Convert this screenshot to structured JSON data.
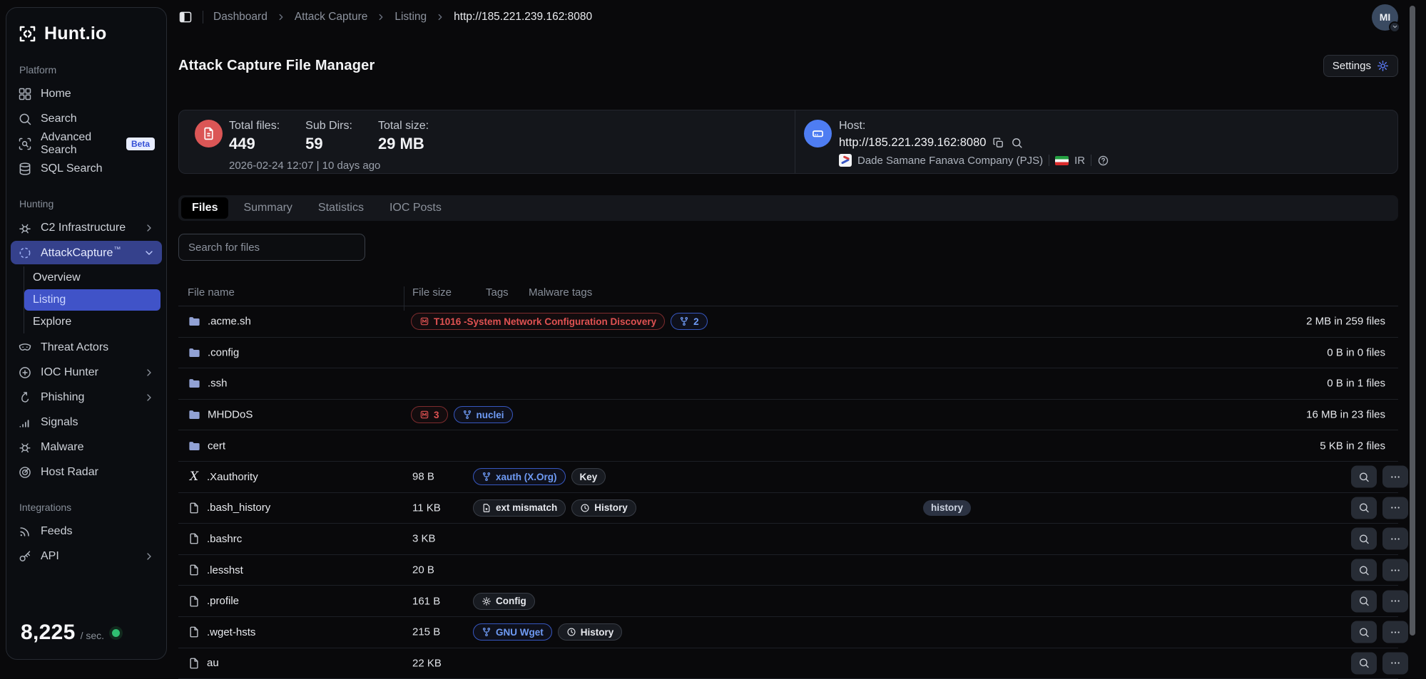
{
  "colors": {
    "accent": "#5c7cfa",
    "danger": "#e05252",
    "success": "#2fbf71",
    "active_nav": "#4053c8"
  },
  "sidebar": {
    "brand": "Hunt.io",
    "sections": [
      {
        "label": "Platform",
        "items": [
          {
            "label": "Home"
          },
          {
            "label": "Search"
          },
          {
            "label": "Advanced Search",
            "badge": "Beta"
          },
          {
            "label": "SQL Search"
          }
        ]
      },
      {
        "label": "Hunting",
        "items": [
          {
            "label": "C2 Infrastructure"
          },
          {
            "label": "AttackCapture",
            "tm": "™"
          },
          {
            "label": "Threat Actors"
          },
          {
            "label": "IOC Hunter"
          },
          {
            "label": "Phishing"
          },
          {
            "label": "Signals"
          },
          {
            "label": "Malware"
          },
          {
            "label": "Host Radar"
          }
        ]
      },
      {
        "label": "Integrations",
        "items": [
          {
            "label": "Feeds"
          },
          {
            "label": "API"
          }
        ]
      }
    ],
    "attackcapture_children": [
      {
        "label": "Overview"
      },
      {
        "label": "Listing"
      },
      {
        "label": "Explore"
      }
    ],
    "rate": {
      "value": "8,225",
      "unit": "/ sec."
    }
  },
  "topbar": {
    "breadcrumb": [
      "Dashboard",
      "Attack Capture",
      "Listing"
    ],
    "current": "http://185.221.239.162:8080",
    "avatar": "MI"
  },
  "header": {
    "title": "Attack Capture File Manager",
    "settings_label": "Settings"
  },
  "overview": {
    "stats": [
      {
        "label": "Total files:",
        "value": "449"
      },
      {
        "label": "Sub Dirs:",
        "value": "59"
      },
      {
        "label": "Total size:",
        "value": "29 MB"
      }
    ],
    "timestamp": "2026-02-24 12:07 | 10 days ago",
    "host": {
      "label": "Host:",
      "url": "http://185.221.239.162:8080",
      "org": "Dade Samane Fanava Company (PJS)",
      "country": "IR"
    }
  },
  "tabs": [
    {
      "label": "Files"
    },
    {
      "label": "Summary"
    },
    {
      "label": "Statistics"
    },
    {
      "label": "IOC Posts"
    }
  ],
  "search": {
    "placeholder": "Search for files"
  },
  "table": {
    "columns": [
      "File name",
      "File size",
      "Tags",
      "Malware tags"
    ],
    "rows": [
      {
        "name": ".acme.sh",
        "type": "folder",
        "summary": "2 MB in 259 files",
        "tags": [
          {
            "label": "T1016 -System Network Configuration Discovery",
            "style": "red"
          },
          {
            "label": "2",
            "style": "blue"
          }
        ]
      },
      {
        "name": ".config",
        "type": "folder",
        "summary": "0 B in 0 files",
        "tags": []
      },
      {
        "name": ".ssh",
        "type": "folder",
        "summary": "0 B in 1 files",
        "tags": []
      },
      {
        "name": "MHDDoS",
        "type": "folder",
        "summary": "16 MB in 23 files",
        "tags": [
          {
            "label": "3",
            "style": "red"
          },
          {
            "label": "nuclei",
            "style": "blue"
          }
        ]
      },
      {
        "name": "cert",
        "type": "folder",
        "summary": "5 KB in 2 files",
        "tags": []
      },
      {
        "name": ".Xauthority",
        "type": "file",
        "size": "98 B",
        "tags": [
          {
            "label": "xauth (X.Org)",
            "style": "blue"
          },
          {
            "label": "Key",
            "style": "dark"
          }
        ]
      },
      {
        "name": ".bash_history",
        "type": "file",
        "size": "11 KB",
        "tags": [
          {
            "label": "ext mismatch",
            "style": "dark"
          },
          {
            "label": "History",
            "style": "dark"
          }
        ],
        "malware_tags": [
          {
            "label": "history"
          }
        ]
      },
      {
        "name": ".bashrc",
        "type": "file",
        "size": "3 KB",
        "tags": []
      },
      {
        "name": ".lesshst",
        "type": "file",
        "size": "20 B",
        "tags": []
      },
      {
        "name": ".profile",
        "type": "file",
        "size": "161 B",
        "tags": [
          {
            "label": "Config",
            "style": "dark"
          }
        ]
      },
      {
        "name": ".wget-hsts",
        "type": "file",
        "size": "215 B",
        "tags": [
          {
            "label": "GNU Wget",
            "style": "blue"
          },
          {
            "label": "History",
            "style": "dark"
          }
        ]
      },
      {
        "name": "au",
        "type": "file",
        "size": "22 KB",
        "tags": []
      }
    ]
  }
}
